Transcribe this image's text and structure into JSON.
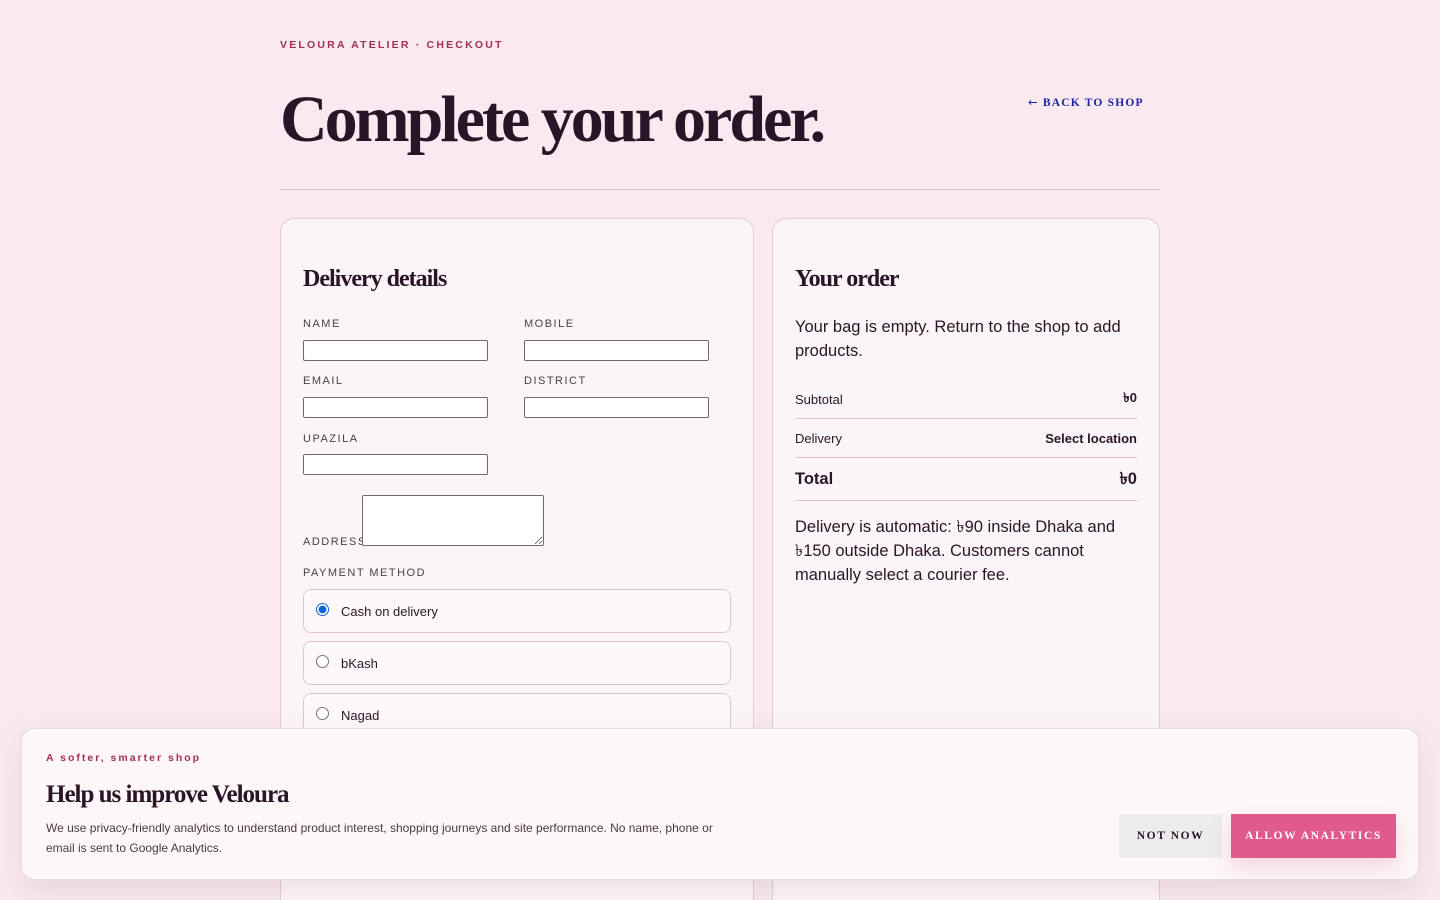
{
  "header": {
    "eyebrow": "VELOURA ATELIER · CHECKOUT",
    "title": "Complete your order.",
    "back_arrow": "←",
    "back_label": "BACK TO SHOP"
  },
  "delivery": {
    "title": "Delivery details",
    "fields": {
      "name": {
        "label": "NAME",
        "value": ""
      },
      "mobile": {
        "label": "MOBILE",
        "value": ""
      },
      "email": {
        "label": "EMAIL",
        "value": ""
      },
      "district": {
        "label": "DISTRICT",
        "value": ""
      },
      "upazila": {
        "label": "UPAZILA",
        "value": ""
      },
      "address": {
        "label": "ADDRESS",
        "value": ""
      }
    },
    "payment": {
      "label": "PAYMENT METHOD",
      "options": [
        {
          "label": "Cash on delivery",
          "selected": true
        },
        {
          "label": "bKash",
          "selected": false
        },
        {
          "label": "Nagad",
          "selected": false
        }
      ]
    }
  },
  "order": {
    "title": "Your order",
    "empty_message": "Your bag is empty. Return to the shop to add products.",
    "subtotal_label": "Subtotal",
    "subtotal_value": "৳0",
    "delivery_label": "Delivery",
    "delivery_value": "Select location",
    "total_label": "Total",
    "total_value": "৳0",
    "note": "Delivery is automatic: ৳90 inside Dhaka and ৳150 outside Dhaka. Customers cannot manually select a courier fee."
  },
  "consent": {
    "tag": "A softer, smarter shop",
    "title": "Help us improve Veloura",
    "body": "We use privacy-friendly analytics to understand product interest, shopping journeys and site performance. No name, phone or email is sent to Google Analytics.",
    "decline_label": "NOT NOW",
    "accept_label": "ALLOW ANALYTICS"
  },
  "colors": {
    "page_bg": "#f8eaf0",
    "accent": "#e05a8e",
    "eyebrow": "#a3304f",
    "link": "#1f22a0",
    "ink": "#2a1528"
  }
}
